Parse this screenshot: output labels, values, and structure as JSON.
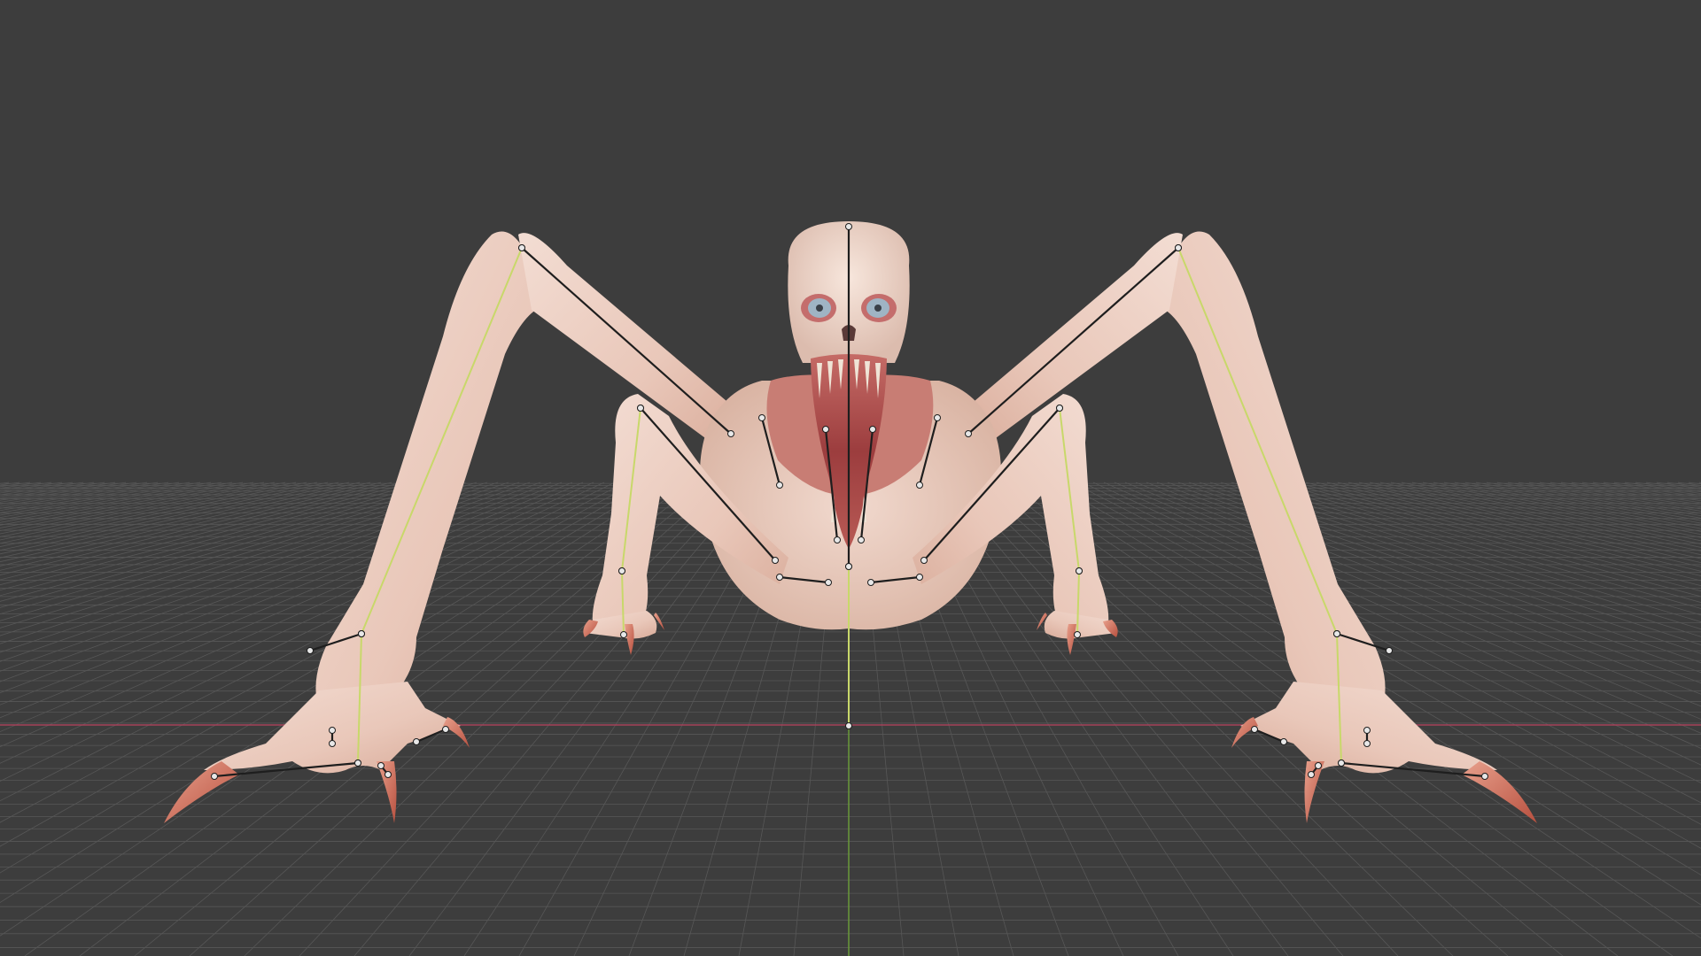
{
  "viewport": {
    "background_color": "#3d3d3d",
    "grid_line_color": "#575757",
    "x_axis_color": "#a5425a",
    "y_axis_color": "#6a9a3a",
    "bone_color": "#1e1e1e",
    "bone_joint_color": "#e8e8e8",
    "selected_bone_color": "#c8d86a",
    "skin_color": "#efd2c6",
    "flesh_color": "#b04a4a",
    "claw_color": "#d8806c",
    "eye_color": "#9fb4c4"
  },
  "scene": {
    "object": "creature-model",
    "armature_visible": true,
    "view": "front-orthographic"
  }
}
